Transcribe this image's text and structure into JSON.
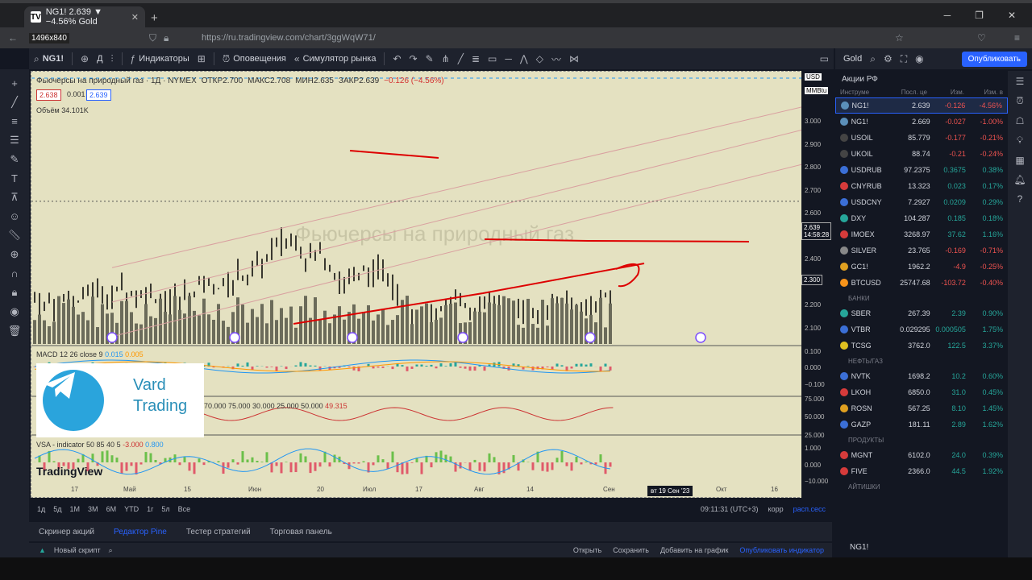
{
  "browser": {
    "tab_title": "NG1! 2.639 ▼ −4.56% Gold",
    "resolution": "1496x840",
    "url": "https://ru.tradingview.com/chart/3ggWqW71/"
  },
  "toolbar": {
    "symbol": "NG1!",
    "interval": "Д",
    "indicators": "Индикаторы",
    "alerts": "Оповещения",
    "simulator": "Симулятор рынка"
  },
  "right_top": {
    "account": "Gold",
    "account_sub": "Сохранить",
    "publish": "Опубликовать"
  },
  "legend": {
    "title": "Фьючерсы на природный газ · 1Д · NYMEX",
    "currency": "USD",
    "open": "ОТКР2.700",
    "high": "МАКС2.708",
    "low": "МИН2.635",
    "close": "ЗАКР2.639",
    "change": "−0.126 (−4.56%)",
    "bid": "2.638",
    "spread": "0.001",
    "ask": "2.639",
    "volume_label": "Объём",
    "volume": "34.101K",
    "units": "MMBtu"
  },
  "indicators": {
    "macd": "MACD 12 26 close 9",
    "macd_v1": "0.015",
    "macd_v2": "0.005",
    "osc": "70.000 75.000 30.000 25.000 50.000",
    "osc_v": "49.315",
    "vsa": "VSA - indicator 50 85 40 5",
    "vsa_v1": "-3.000",
    "vsa_v2": "0.800"
  },
  "promo": {
    "line1": "Vard",
    "line2": "Trading"
  },
  "logo": "TradingView",
  "yaxis": [
    "3.000",
    "2.900",
    "2.800",
    "2.700",
    "2.600",
    "2.500",
    "2.400",
    "2.300",
    "2.200",
    "2.100"
  ],
  "yaxis_ind": [
    "0.100",
    "0.000",
    "−0.100",
    "75.000",
    "50.000",
    "25.000",
    "1.000",
    "0.000",
    "−10.000"
  ],
  "last_price": "2.639",
  "countdown": "14:58:28",
  "cursor_price": "2.300",
  "xaxis": [
    "17",
    "Май",
    "15",
    "Июн",
    "20",
    "Июл",
    "17",
    "Авг",
    "14",
    "Сен",
    "Окт",
    "16"
  ],
  "cursor_date": "вт 19 Сен '23",
  "ranges": [
    "1д",
    "5д",
    "1М",
    "3М",
    "6М",
    "YTD",
    "1г",
    "5л",
    "Все"
  ],
  "clock": "09:11:31 (UTC+3)",
  "corr": "корр",
  "session": "расп.сесс",
  "bottom_tabs": [
    "Скринер акций",
    "Редактор Pine",
    "Тестер стратегий",
    "Торговая панель"
  ],
  "script": {
    "name": "Новый скрипт",
    "open": "Открыть",
    "save": "Сохранить",
    "add": "Добавить на график",
    "publish": "Опубликовать индикатор"
  },
  "watch": {
    "title": "Акции РФ",
    "cols": [
      "Инструме",
      "Посл. це",
      "Изм.",
      "Изм. в"
    ],
    "rows": [
      {
        "sym": "NG1!",
        "last": "2.639",
        "chg": "-0.126",
        "pct": "-4.56%",
        "dir": "dn",
        "color": "#5b8fb9",
        "sel": true
      },
      {
        "sym": "NG1!",
        "last": "2.669",
        "chg": "-0.027",
        "pct": "-1.00%",
        "dir": "dn",
        "color": "#5b8fb9"
      },
      {
        "sym": "USOIL",
        "last": "85.779",
        "chg": "-0.177",
        "pct": "-0.21%",
        "dir": "dn",
        "color": "#444"
      },
      {
        "sym": "UKOIL",
        "last": "88.74",
        "chg": "-0.21",
        "pct": "-0.24%",
        "dir": "dn",
        "color": "#444"
      },
      {
        "sym": "USDRUB",
        "last": "97.2375",
        "chg": "0.3675",
        "pct": "0.38%",
        "dir": "up",
        "color": "#3b6fd6"
      },
      {
        "sym": "CNYRUB",
        "last": "13.323",
        "chg": "0.023",
        "pct": "0.17%",
        "dir": "up",
        "color": "#d63b3b"
      },
      {
        "sym": "USDCNY",
        "last": "7.2927",
        "chg": "0.0209",
        "pct": "0.29%",
        "dir": "up",
        "color": "#3b6fd6"
      },
      {
        "sym": "DXY",
        "last": "104.287",
        "chg": "0.185",
        "pct": "0.18%",
        "dir": "up",
        "color": "#26a69a"
      },
      {
        "sym": "IMOEX",
        "last": "3268.97",
        "chg": "37.62",
        "pct": "1.16%",
        "dir": "up",
        "color": "#d63b3b"
      },
      {
        "sym": "SILVER",
        "last": "23.765",
        "chg": "-0.169",
        "pct": "-0.71%",
        "dir": "dn",
        "color": "#888"
      },
      {
        "sym": "GC1!",
        "last": "1962.2",
        "chg": "-4.9",
        "pct": "-0.25%",
        "dir": "dn",
        "color": "#e0a020"
      },
      {
        "sym": "BTCUSD",
        "last": "25747.68",
        "chg": "-103.72",
        "pct": "-0.40%",
        "dir": "dn",
        "color": "#f7931a"
      }
    ],
    "sections": [
      {
        "name": "БАНКИ",
        "rows": [
          {
            "sym": "SBER",
            "last": "267.39",
            "chg": "2.39",
            "pct": "0.90%",
            "dir": "up",
            "color": "#26a69a"
          },
          {
            "sym": "VTBR",
            "last": "0.029295",
            "chg": "0.000505",
            "pct": "1.75%",
            "dir": "up",
            "color": "#3b6fd6"
          },
          {
            "sym": "TCSG",
            "last": "3762.0",
            "chg": "122.5",
            "pct": "3.37%",
            "dir": "up",
            "color": "#e0c020"
          }
        ]
      },
      {
        "name": "НЕФТЬ/ГАЗ",
        "rows": [
          {
            "sym": "NVTK",
            "last": "1698.2",
            "chg": "10.2",
            "pct": "0.60%",
            "dir": "up",
            "color": "#3b6fd6"
          },
          {
            "sym": "LKOH",
            "last": "6850.0",
            "chg": "31.0",
            "pct": "0.45%",
            "dir": "up",
            "color": "#d63b3b"
          },
          {
            "sym": "ROSN",
            "last": "567.25",
            "chg": "8.10",
            "pct": "1.45%",
            "dir": "up",
            "color": "#e0a020"
          },
          {
            "sym": "GAZP",
            "last": "181.11",
            "chg": "2.89",
            "pct": "1.62%",
            "dir": "up",
            "color": "#3b6fd6"
          }
        ]
      },
      {
        "name": "ПРОДУКТЫ",
        "rows": [
          {
            "sym": "MGNT",
            "last": "6102.0",
            "chg": "24.0",
            "pct": "0.39%",
            "dir": "up",
            "color": "#d63b3b"
          },
          {
            "sym": "FIVE",
            "last": "2366.0",
            "chg": "44.5",
            "pct": "1.92%",
            "dir": "up",
            "color": "#d63b3b"
          }
        ]
      }
    ],
    "last_section": "АЙТИШКИ",
    "footer": "NG1!"
  }
}
